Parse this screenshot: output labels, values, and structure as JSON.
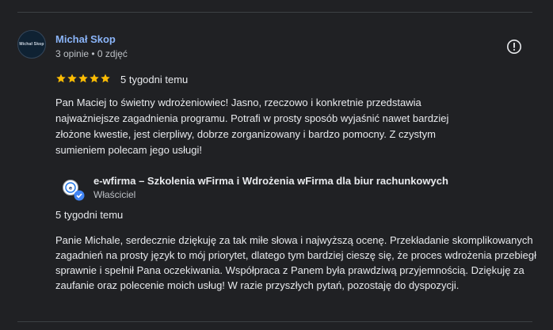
{
  "review": {
    "reviewer_name": "Michał Skop",
    "reviewer_meta": "3 opinie • 0 zdjęć",
    "avatar_logo": "Michał Skop",
    "rating": 5,
    "time": "5 tygodni temu",
    "text": "Pan Maciej to świetny wdrożeniowiec! Jasno, rzeczowo i konkretnie przedstawia najważniejsze zagadnienia programu. Potrafi w prosty sposób wyjaśnić nawet bardziej złożone kwestie, jest cierpliwy, dobrze zorganizowany i bardzo pomocny. Z czystym sumieniem polecam jego usługi!"
  },
  "owner_reply": {
    "name": "e-wfirma – Szkolenia wFirma i Wdrożenia wFirma dla biur rachunkowych",
    "role": "Właściciel",
    "time": "5 tygodni temu",
    "text": "Panie Michale, serdecznie dziękuję za tak miłe słowa i najwyższą ocenę. Przekładanie skomplikowanych zagadnień na prosty język to mój priorytet, dlatego tym bardziej cieszę się, że proces wdrożenia przebiegł sprawnie i spełnił Pana oczekiwania. Współpraca z Panem była prawdziwą przyjemnością. Dziękuję za zaufanie oraz polecenie moich usług! W razie przyszłych pytań, pozostaję do dyspozycji."
  },
  "colors": {
    "background": "#202124",
    "star": "#fbbc04",
    "link_name": "#8ab4f8",
    "verified_badge": "#4285f4"
  }
}
